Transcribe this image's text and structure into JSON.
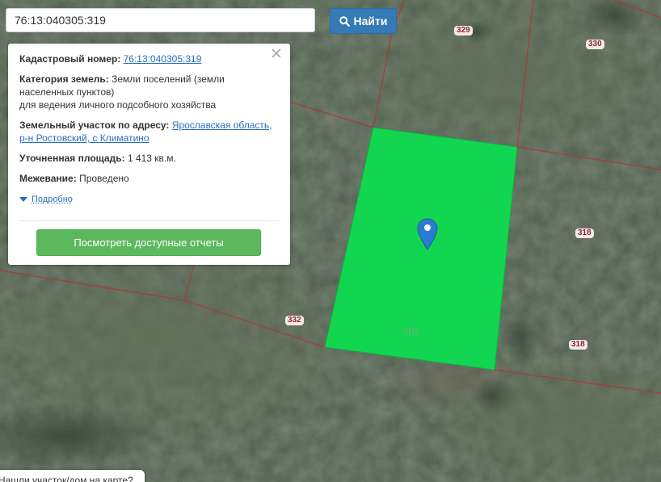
{
  "search": {
    "value": "76:13:040305:319",
    "button_label": "Найти"
  },
  "popup": {
    "cadastral_label": "Кадастровый номер:",
    "cadastral_value": "76:13:040305:319",
    "category_label": "Категория земель:",
    "category_value": "Земли поселений (земли населенных пунктов)",
    "category_use": "для ведения личного подсобного хозяйства",
    "address_label": "Земельный участок по адресу:",
    "address_value": "Ярославская область, р-н Ростовский, с Климатино",
    "area_label": "Уточненная площадь:",
    "area_value": "1 413 кв.м.",
    "survey_label": "Межевание:",
    "survey_value": "Проведено",
    "more_label": "Подробно",
    "reports_button": "Посмотреть доступные отчеты"
  },
  "hint": {
    "text": "Нашли участок/дом на карте?"
  },
  "map": {
    "parcel_labels": [
      {
        "id": "329",
        "text": "329"
      },
      {
        "id": "330",
        "text": "330"
      },
      {
        "id": "318a",
        "text": "318"
      },
      {
        "id": "332",
        "text": "332"
      },
      {
        "id": "318b",
        "text": "318"
      },
      {
        "id": "319",
        "text": "319"
      }
    ],
    "colors": {
      "parcel_fill": "#12d650",
      "boundary": "#b83232",
      "marker": "#2b7bd0",
      "accent_button": "#337ab7",
      "reports_button": "#5cb85c"
    }
  }
}
